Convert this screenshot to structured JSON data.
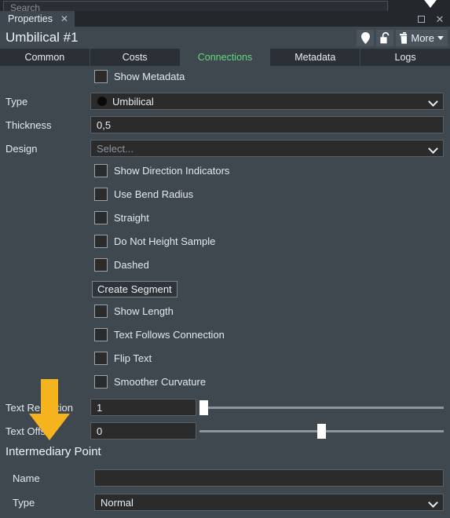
{
  "top_strip": {
    "search_placeholder": "Search",
    "chevron_icon": "chevron-down-icon"
  },
  "panel": {
    "tab_label": "Properties",
    "close_icon": "✕",
    "maximize_icon": "maximize-icon",
    "window_close_icon": "✕"
  },
  "header": {
    "object_title": "Umbilical #1",
    "tools": [
      {
        "name": "location-pin-icon",
        "glyph": "pin"
      },
      {
        "name": "unlock-icon",
        "glyph": "lock"
      },
      {
        "name": "delete-icon",
        "glyph": "trash"
      }
    ],
    "more_label": "More"
  },
  "tabs": [
    {
      "label": "Common",
      "active": false
    },
    {
      "label": "Costs",
      "active": false
    },
    {
      "label": "Connections",
      "active": true
    },
    {
      "label": "Metadata",
      "active": false
    },
    {
      "label": "Logs",
      "active": false
    }
  ],
  "accent_color": "#5fd97e",
  "annotation_color": "#f5b31e",
  "form": {
    "show_metadata_label": "Show Metadata",
    "type_label": "Type",
    "type_value": "Umbilical",
    "type_swatch_color": "#0a0a0a",
    "thickness_label": "Thickness",
    "thickness_value": "0,5",
    "design_label": "Design",
    "design_placeholder": "Select...",
    "checkboxes_upper": [
      "Show Direction Indicators",
      "Use Bend Radius",
      "Straight",
      "Do Not Height Sample",
      "Dashed"
    ],
    "create_segment_label": "Create Segment",
    "checkboxes_lower": [
      "Show Length",
      "Text Follows Connection",
      "Flip Text",
      "Smoother Curvature"
    ],
    "text_repetition_label": "Text Repetition",
    "text_repetition_value": "1",
    "text_offset_label": "Text Offset",
    "text_offset_value": "0",
    "intermediary_heading": "Intermediary Point",
    "name_label": "Name",
    "name_value": "",
    "ip_type_label": "Type",
    "ip_type_value": "Normal"
  }
}
